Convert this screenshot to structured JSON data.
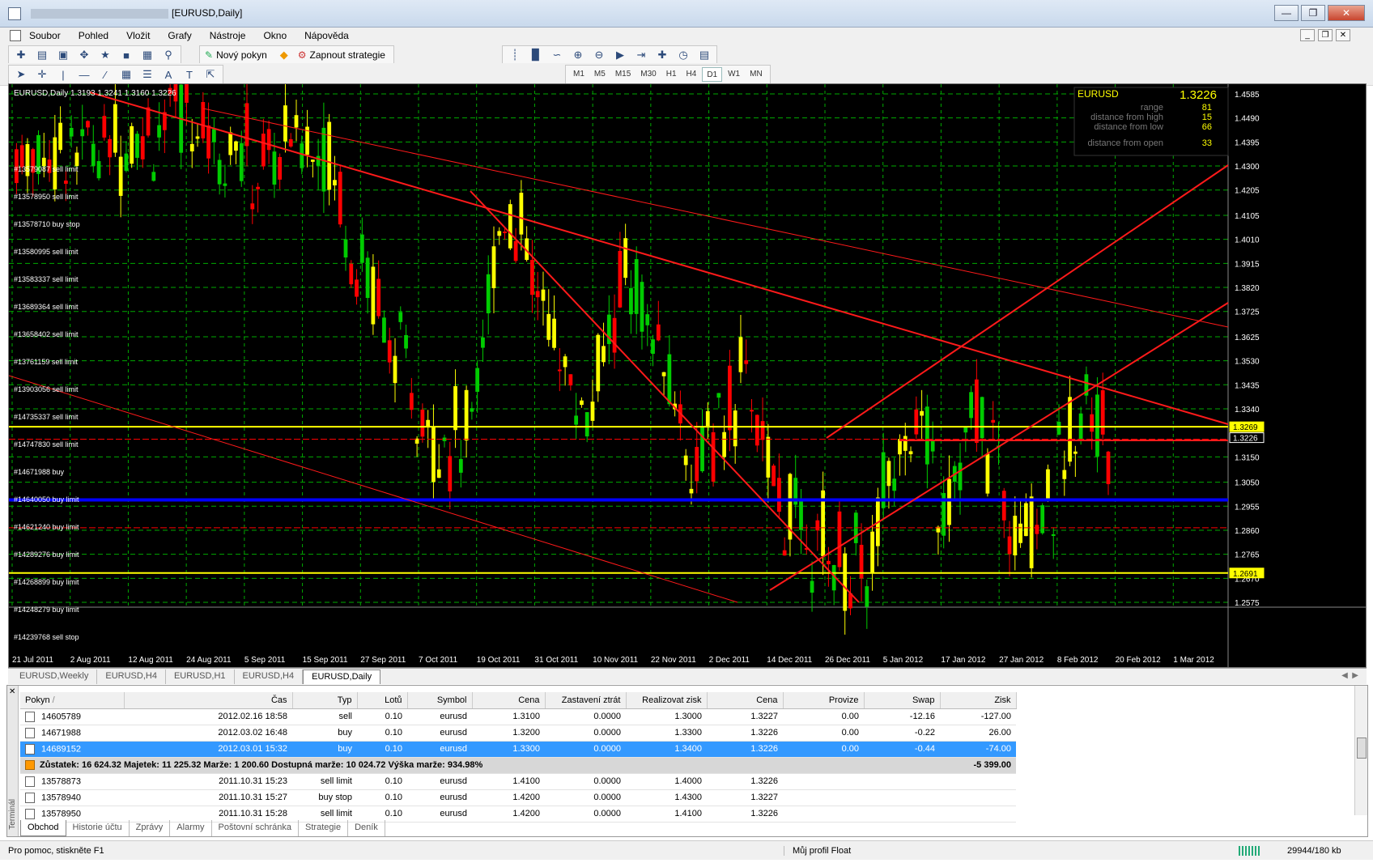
{
  "window": {
    "title": "[EURUSD,Daily]",
    "minimize": "0",
    "maximize": "1",
    "close": "r"
  },
  "menu": {
    "items": [
      "Soubor",
      "Pohled",
      "Vložit",
      "Grafy",
      "Nástroje",
      "Okno",
      "Nápověda"
    ]
  },
  "toolbar": {
    "new_order": "Nový pokyn",
    "strategies": "Zapnout strategie",
    "timeframes": [
      "M1",
      "M5",
      "M15",
      "M30",
      "H1",
      "H4",
      "D1",
      "W1",
      "MN"
    ],
    "active_timeframe": "D1"
  },
  "chart": {
    "header": "EURUSD,Daily  1.3193 1.3241 1.3160 1.3226",
    "info_panel": {
      "symbol": "EURUSD",
      "price": "1.3226",
      "rows": [
        {
          "label": "range",
          "value": "81"
        },
        {
          "label": "distance from high",
          "value": "15"
        },
        {
          "label": "distance from low",
          "value": "66"
        },
        {
          "label": "distance from open",
          "value": "33"
        }
      ]
    },
    "y_ticks": [
      "1.4585",
      "1.4490",
      "1.4395",
      "1.4300",
      "1.4205",
      "1.4105",
      "1.4010",
      "1.3915",
      "1.3820",
      "1.3725",
      "1.3625",
      "1.3530",
      "1.3435",
      "1.3340",
      "1.3150",
      "1.3050",
      "1.2955",
      "1.2860",
      "1.2765",
      "1.2670",
      "1.2575"
    ],
    "y_range": [
      1.2575,
      1.4585
    ],
    "price_labels": [
      {
        "text": "1.3269",
        "value": 1.3269,
        "color": "#ffff00"
      },
      {
        "text": "1.3226",
        "value": 1.3226,
        "color": "#ffffff"
      },
      {
        "text": "1.2691",
        "value": 1.2691,
        "color": "#ffff00"
      }
    ],
    "x_ticks": [
      "21 Jul 2011",
      "2 Aug 2011",
      "12 Aug 2011",
      "24 Aug 2011",
      "5 Sep 2011",
      "15 Sep 2011",
      "27 Sep 2011",
      "7 Oct 2011",
      "19 Oct 2011",
      "31 Oct 2011",
      "10 Nov 2011",
      "22 Nov 2011",
      "2 Dec 2011",
      "14 Dec 2011",
      "26 Dec 2011",
      "5 Jan 2012",
      "17 Jan 2012",
      "27 Jan 2012",
      "8 Feb 2012",
      "20 Feb 2012",
      "1 Mar 2012"
    ],
    "order_labels": [
      "#13579087 sell limit",
      "#13578950 sell limit",
      "#13578710 buy stop",
      "#13580995 sell limit",
      "#13583337 sell limit",
      "#13689364 sell limit",
      "#13658402 sell limit",
      "#13761159 sell limit",
      "#13903056 sell limit",
      "#14735337 sell limit",
      "#14747830 sell limit",
      "#14671988 buy",
      "#14640050 buy limit",
      "#14621240 buy limit",
      "#14289276 buy limit",
      "#14268899 buy limit",
      "#14248279 buy limit",
      "#14239768 sell stop"
    ],
    "hlines": [
      {
        "value": 1.3269,
        "color": "#ffff00",
        "width": 2
      },
      {
        "value": 1.2691,
        "color": "#ffff00",
        "width": 2
      },
      {
        "value": 1.298,
        "color": "#0000ff",
        "width": 4
      },
      {
        "value": 1.322,
        "color": "#ff0000",
        "width": 1
      },
      {
        "value": 1.287,
        "color": "#ff0000",
        "width": 1
      }
    ]
  },
  "chart_tabs": [
    "EURUSD,Weekly",
    "EURUSD,H4",
    "EURUSD,H1",
    "EURUSD,H4",
    "EURUSD,Daily"
  ],
  "active_chart_tab": 4,
  "terminal": {
    "side_label": "Terminál",
    "columns": [
      "Pokyn",
      "Čas",
      "Typ",
      "Lotů",
      "Symbol",
      "Cena",
      "Zastavení ztrát",
      "Realizovat zisk",
      "Cena",
      "Provize",
      "Swap",
      "Zisk"
    ],
    "orders": [
      [
        "14605789",
        "2012.02.16 18:58",
        "sell",
        "0.10",
        "eurusd",
        "1.3100",
        "0.0000",
        "1.3000",
        "1.3227",
        "0.00",
        "-12.16",
        "-127.00"
      ],
      [
        "14671988",
        "2012.03.02 16:48",
        "buy",
        "0.10",
        "eurusd",
        "1.3200",
        "0.0000",
        "1.3300",
        "1.3226",
        "0.00",
        "-0.22",
        "26.00"
      ],
      [
        "14689152",
        "2012.03.01 15:32",
        "buy",
        "0.10",
        "eurusd",
        "1.3300",
        "0.0000",
        "1.3400",
        "1.3226",
        "0.00",
        "-0.44",
        "-74.00"
      ]
    ],
    "summary": {
      "text": "Zůstatek: 16 624.32  Majetek: 11 225.32  Marže: 1 200.60  Dostupná marže: 10 024.72  Výška marže: 934.98%",
      "profit": "-5 399.00"
    },
    "pending": [
      [
        "13578873",
        "2011.10.31 15:23",
        "sell limit",
        "0.10",
        "eurusd",
        "1.4100",
        "0.0000",
        "1.4000",
        "1.3226"
      ],
      [
        "13578940",
        "2011.10.31 15:27",
        "buy stop",
        "0.10",
        "eurusd",
        "1.4200",
        "0.0000",
        "1.4300",
        "1.3227"
      ],
      [
        "13578950",
        "2011.10.31 15:28",
        "sell limit",
        "0.10",
        "eurusd",
        "1.4200",
        "0.0000",
        "1.4100",
        "1.3226"
      ]
    ],
    "tabs": [
      "Obchod",
      "Historie účtu",
      "Zprávy",
      "Alarmy",
      "Poštovní schránka",
      "Strategie",
      "Deník"
    ],
    "active_tab": 0
  },
  "status": {
    "help": "Pro pomoc, stiskněte F1",
    "profile": "Můj profil Float",
    "traffic": "29944/180 kb"
  },
  "colors": {
    "bull": "#00cc00",
    "bear": "#ff0000",
    "doji": "#ffff00",
    "grid": "#00aa00",
    "trend": "#ff1a1a"
  }
}
